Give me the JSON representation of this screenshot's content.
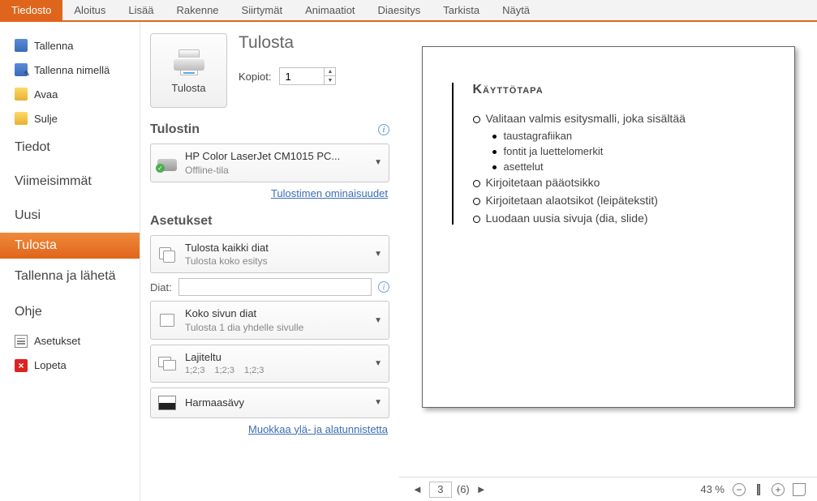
{
  "ribbon": {
    "tabs": [
      "Tiedosto",
      "Aloitus",
      "Lisää",
      "Rakenne",
      "Siirtymät",
      "Animaatiot",
      "Diaesitys",
      "Tarkista",
      "Näytä"
    ],
    "active_index": 0
  },
  "nav": {
    "save": "Tallenna",
    "save_as": "Tallenna nimellä",
    "open": "Avaa",
    "close": "Sulje",
    "info": "Tiedot",
    "recent": "Viimeisimmät",
    "new": "Uusi",
    "print": "Tulosta",
    "send": "Tallenna ja lähetä",
    "help": "Ohje",
    "options": "Asetukset",
    "exit": "Lopeta"
  },
  "print": {
    "title": "Tulosta",
    "button": "Tulosta",
    "copies_label": "Kopiot:",
    "copies_value": "1",
    "printer_heading": "Tulostin",
    "printer_name": "HP Color LaserJet CM1015 PC...",
    "printer_status": "Offline-tila",
    "printer_props": "Tulostimen ominaisuudet",
    "settings_heading": "Asetukset",
    "dd_all_l1": "Tulosta kaikki diat",
    "dd_all_l2": "Tulosta koko esitys",
    "slides_label": "Diat:",
    "slides_value": "",
    "dd_layout_l1": "Koko sivun diat",
    "dd_layout_l2": "Tulosta 1 dia yhdelle sivulle",
    "dd_sort_l1": "Lajiteltu",
    "dd_sort_nums": "1;2;3",
    "dd_color": "Harmaasävy",
    "edit_hf": "Muokkaa ylä- ja alatunnistetta"
  },
  "preview": {
    "page_current": "3",
    "page_total": "(6)",
    "zoom": "43 %",
    "slide": {
      "title": "Käyttötapa",
      "items": [
        {
          "t": "o",
          "text": "Valitaan valmis esitysmalli, joka sisältää"
        },
        {
          "t": "b",
          "text": "taustagrafiikan"
        },
        {
          "t": "b",
          "text": "fontit ja luettelomerkit"
        },
        {
          "t": "b",
          "text": "asettelut"
        },
        {
          "t": "o",
          "text": "Kirjoitetaan pääotsikko"
        },
        {
          "t": "o",
          "text": "Kirjoitetaan alaotsikot (leipätekstit)"
        },
        {
          "t": "o",
          "text": "Luodaan uusia sivuja (dia, slide)"
        }
      ]
    }
  }
}
